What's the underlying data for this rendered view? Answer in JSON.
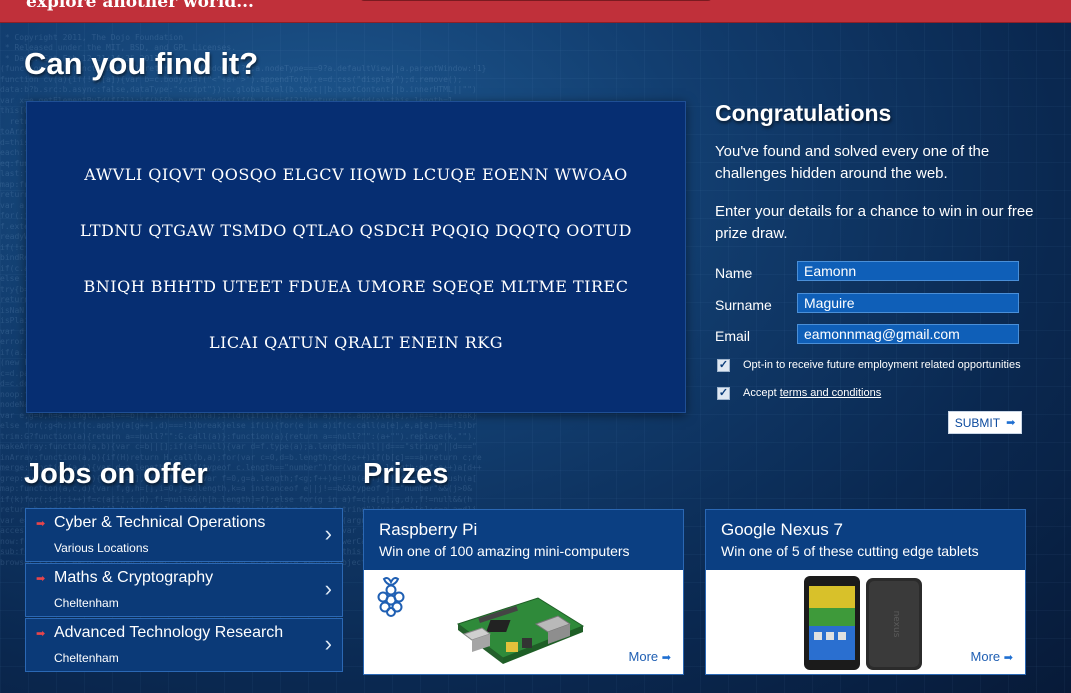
{
  "header": {
    "tagline": "explore another world..."
  },
  "puzzle": {
    "title": "Can you find it?",
    "lines": [
      "AWVLI QIQVT QOSQO ELGCV IIQWD LCUQE EOENN WWOAO",
      "LTDNU QTGAW TSMDO QTLAO QSDCH PQQIQ DQQTQ OOTUD",
      "BNIQH BHHTD UTEET FDUEA UMORE SQEQE MLTME TIREC",
      "LICAI QATUN QRALT ENEIN RKG"
    ]
  },
  "congrats": {
    "title": "Congratulations",
    "text1": "You've found and solved every one of the challenges hidden around the web.",
    "text2": "Enter your details for a chance to win in our free prize draw."
  },
  "form": {
    "name_label": "Name",
    "name_value": "Eamonn",
    "surname_label": "Surname",
    "surname_value": "Maguire",
    "email_label": "Email",
    "email_value": "eamonnmag@gmail.com",
    "optin_label": "Opt-in to receive future employment related opportunities",
    "optin_checked": true,
    "accept_label": "Accept",
    "terms_link": "terms and conditions",
    "accept_checked": true,
    "submit_label": "SUBMIT"
  },
  "jobs": {
    "title": "Jobs on offer",
    "items": [
      {
        "title": "Cyber & Technical Operations",
        "location": "Various Locations"
      },
      {
        "title": "Maths & Cryptography",
        "location": "Cheltenham"
      },
      {
        "title": "Advanced Technology Research",
        "location": "Cheltenham"
      }
    ]
  },
  "prizes": {
    "title": "Prizes",
    "items": [
      {
        "title": "Raspberry Pi",
        "subtitle": "Win one of 100 amazing mini-computers",
        "more": "More"
      },
      {
        "title": "Google Nexus 7",
        "subtitle": "Win one of 5 of these cutting edge tablets",
        "more": "More"
      }
    ]
  },
  "colors": {
    "topbar": "#c0303a",
    "panel": "#062e72",
    "accent_red": "#e8454b",
    "link_blue": "#1f5fb3"
  }
}
